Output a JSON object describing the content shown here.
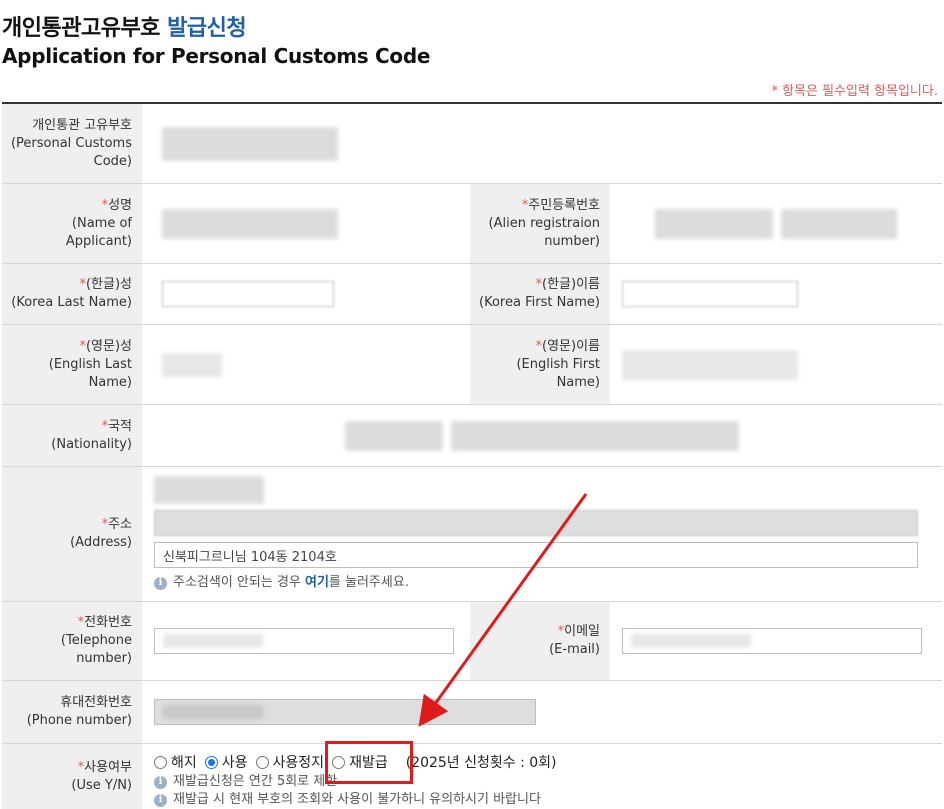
{
  "header": {
    "title_ko_main": "개인통관고유부호 ",
    "title_ko_accent": "발급신청",
    "title_en": "Application for Personal Customs Code",
    "required_note": "* 항목은 필수입력 항목입니다."
  },
  "fields": {
    "customs_code": {
      "label_ko": "개인통관 고유부호",
      "label_en": "(Personal Customs Code)"
    },
    "name": {
      "req": "*",
      "label_ko": "성명",
      "label_en": "(Name of Applicant)"
    },
    "alien_reg": {
      "req": "*",
      "label_ko": "주민등록번호",
      "label_en": "(Alien registraion number)"
    },
    "kor_last": {
      "req": "*",
      "label_ko": "(한글)성",
      "label_en": "(Korea Last Name)"
    },
    "kor_first": {
      "req": "*",
      "label_ko": "(한글)이름",
      "label_en": "(Korea First Name)"
    },
    "eng_last": {
      "req": "*",
      "label_ko": "(영문)성",
      "label_en": "(English Last Name)"
    },
    "eng_first": {
      "req": "*",
      "label_ko": "(영문)이름",
      "label_en": "(English First Name)"
    },
    "nationality": {
      "req": "*",
      "label_ko": "국적",
      "label_en": "(Nationality)"
    },
    "address": {
      "req": "*",
      "label_ko": "주소",
      "label_en": "(Address)",
      "detail_value": "신북피그르니님 104동 2104호",
      "help_before": "주소검색이 안되는 경우 ",
      "help_link": "여기",
      "help_after": "를 눌러주세요."
    },
    "telephone": {
      "req": "*",
      "label_ko": "전화번호",
      "label_en": "(Telephone number)"
    },
    "email": {
      "req": "*",
      "label_ko": "이메일",
      "label_en": "(E-mail)"
    },
    "mobile": {
      "label_ko": "휴대전화번호",
      "label_en": "(Phone number)"
    },
    "use_yn": {
      "req": "*",
      "label_ko": "사용여부",
      "label_en": "(Use Y/N)",
      "options": [
        "해지",
        "사용",
        "사용정지",
        "재발급"
      ],
      "selected": "사용",
      "count_note": "(2025년 신청횟수 : 0회)",
      "note1": "재발급신청은 연간 5회로 제한",
      "note2": "재발급 시 현재 부호의 조회와 사용이 불가하니 유의하시기 바랍니다"
    }
  },
  "annotation": {
    "arrow_color": "#e01b1b",
    "box_color": "#e01b1b"
  }
}
